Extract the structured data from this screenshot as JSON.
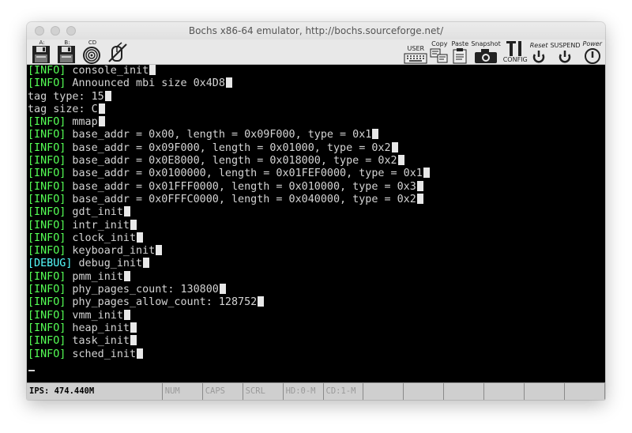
{
  "window": {
    "title": "Bochs x86-64 emulator, http://bochs.sourceforge.net/"
  },
  "toolbar": {
    "left": [
      {
        "label": "A:",
        "icon": "floppy-a-icon"
      },
      {
        "label": "B:",
        "icon": "floppy-b-icon"
      },
      {
        "label": "CD",
        "icon": "cdrom-icon"
      },
      {
        "label": "",
        "icon": "mouse-disabled-icon"
      }
    ],
    "right": [
      {
        "label": "USER",
        "icon": "keyboard-icon"
      },
      {
        "label": "Copy",
        "icon": "copy-icon"
      },
      {
        "label": "Paste",
        "icon": "paste-icon"
      },
      {
        "label": "Snapshot",
        "icon": "camera-icon"
      },
      {
        "label": "CONFIG",
        "icon": "config-icon"
      },
      {
        "label": "Reset",
        "icon": "reset-icon"
      },
      {
        "label": "SUSPEND",
        "icon": "suspend-icon"
      },
      {
        "label": "Power",
        "icon": "power-icon"
      }
    ]
  },
  "console": {
    "lines": [
      {
        "tag": "[INFO]",
        "type": "info",
        "text": " console_init"
      },
      {
        "tag": "[INFO]",
        "type": "info",
        "text": " Announced mbi size 0x4D8"
      },
      {
        "tag": "",
        "type": "plain",
        "text": "tag type: 15"
      },
      {
        "tag": "",
        "type": "plain",
        "text": "tag size: C"
      },
      {
        "tag": "[INFO]",
        "type": "info",
        "text": " mmap"
      },
      {
        "tag": "[INFO]",
        "type": "info",
        "text": " base_addr = 0x00, length = 0x09F000, type = 0x1"
      },
      {
        "tag": "[INFO]",
        "type": "info",
        "text": " base_addr = 0x09F000, length = 0x01000, type = 0x2"
      },
      {
        "tag": "[INFO]",
        "type": "info",
        "text": " base_addr = 0x0E8000, length = 0x018000, type = 0x2"
      },
      {
        "tag": "[INFO]",
        "type": "info",
        "text": " base_addr = 0x0100000, length = 0x01FEF0000, type = 0x1"
      },
      {
        "tag": "[INFO]",
        "type": "info",
        "text": " base_addr = 0x01FFF0000, length = 0x010000, type = 0x3"
      },
      {
        "tag": "[INFO]",
        "type": "info",
        "text": " base_addr = 0x0FFFC0000, length = 0x040000, type = 0x2"
      },
      {
        "tag": "[INFO]",
        "type": "info",
        "text": " gdt_init"
      },
      {
        "tag": "[INFO]",
        "type": "info",
        "text": " intr_init"
      },
      {
        "tag": "[INFO]",
        "type": "info",
        "text": " clock_init"
      },
      {
        "tag": "[INFO]",
        "type": "info",
        "text": " keyboard_init"
      },
      {
        "tag": "[DEBUG]",
        "type": "debug",
        "text": " debug_init"
      },
      {
        "tag": "[INFO]",
        "type": "info",
        "text": " pmm_init"
      },
      {
        "tag": "[INFO]",
        "type": "info",
        "text": " phy_pages_count: 130800"
      },
      {
        "tag": "[INFO]",
        "type": "info",
        "text": " phy_pages_allow_count: 128752"
      },
      {
        "tag": "[INFO]",
        "type": "info",
        "text": " vmm_init"
      },
      {
        "tag": "[INFO]",
        "type": "info",
        "text": " heap_init"
      },
      {
        "tag": "[INFO]",
        "type": "info",
        "text": " task_init"
      },
      {
        "tag": "[INFO]",
        "type": "info",
        "text": " sched_init"
      }
    ]
  },
  "statusbar": {
    "cells": [
      "IPS: 474.440M",
      "NUM",
      "CAPS",
      "SCRL",
      "HD:0-M",
      "CD:1-M",
      "",
      "",
      "",
      "",
      "",
      ""
    ]
  },
  "colors": {
    "info_tag": "#55ff55",
    "debug_tag": "#55ffff",
    "console_text": "#d4d4d4",
    "console_bg": "#000000"
  }
}
